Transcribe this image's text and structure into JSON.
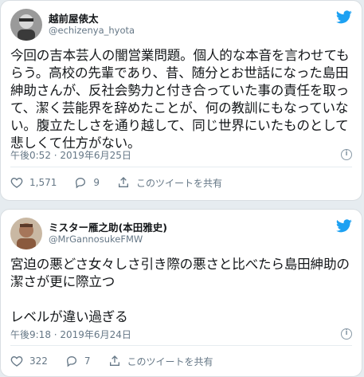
{
  "colors": {
    "accent": "#1da1f2",
    "secondary_text": "#657786",
    "background": "#e6ecf0"
  },
  "tweets": [
    {
      "display_name": "越前屋俵太",
      "handle": "@echizenya_hyota",
      "text": "今回の吉本芸人の闇営業問題。個人的な本音を言わせてもらう。高校の先輩であり、昔、随分とお世話になった島田紳助さんが、反社会勢力と付き合っていた事の責任を取って、潔く芸能界を辞めたことが、何の教訓にもなっていない。腹立たしさを通り越して、同じ世界にいたものとして悲しくて仕方がない。",
      "timestamp": "午後0:52 · 2019年6月25日",
      "likes": "1,571",
      "replies": "9",
      "share_label": "このツイートを共有",
      "icons": [
        "twitter-bird-icon",
        "info-icon",
        "heart-icon",
        "reply-icon",
        "share-icon"
      ]
    },
    {
      "display_name": "ミスター雁之助(本田雅史)",
      "handle": "@MrGannosukeFMW",
      "text": "宮迫の悪どさ女々しさ引き際の悪さと比べたら島田紳助の潔さが更に際立つ\n\nレベルが違い過ぎる",
      "timestamp": "午後9:18 · 2019年6月24日",
      "likes": "322",
      "replies": "7",
      "share_label": "このツイートを共有",
      "icons": [
        "twitter-bird-icon",
        "info-icon",
        "heart-icon",
        "reply-icon",
        "share-icon"
      ]
    }
  ]
}
